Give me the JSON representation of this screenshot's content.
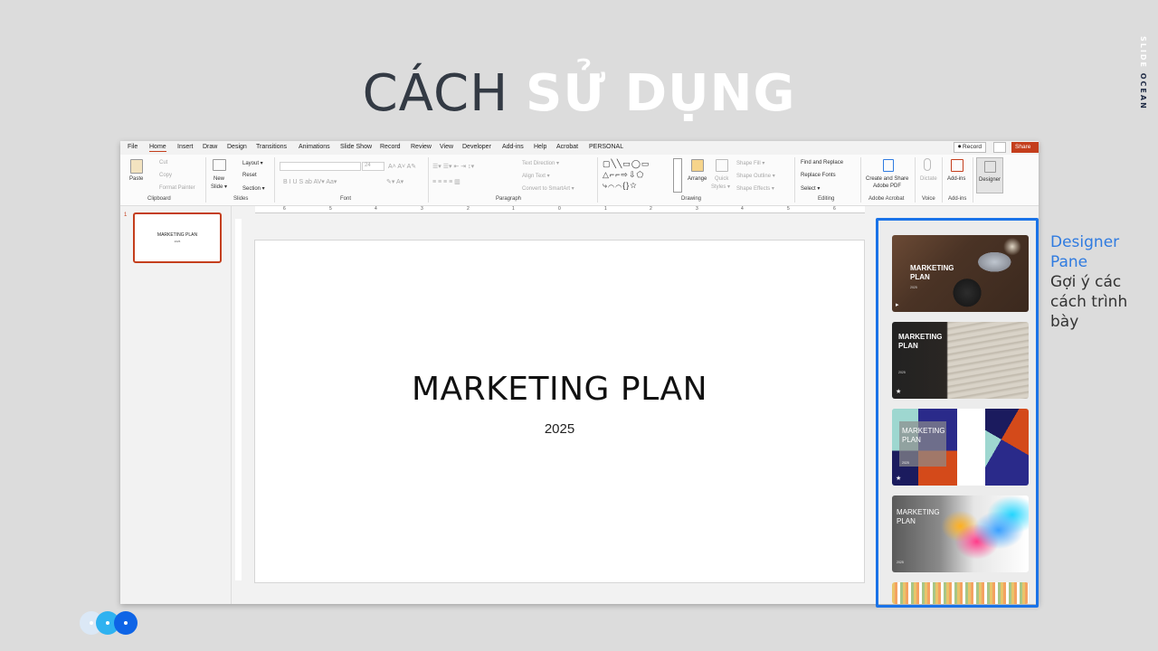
{
  "heading": {
    "part1": "CÁCH ",
    "part2": "SỬ DỤNG"
  },
  "brand": {
    "part1": "SLIDE ",
    "part2": "OCEAN"
  },
  "menu": {
    "tabs": [
      "File",
      "Home",
      "Insert",
      "Draw",
      "Design",
      "Transitions",
      "Animations",
      "Slide Show",
      "Record",
      "Review",
      "View",
      "Developer",
      "Add-ins",
      "Help",
      "Acrobat",
      "PERSONAL"
    ],
    "active_tab": "Home",
    "record_label": "⏺ Record",
    "share_label": "Share"
  },
  "ribbon": {
    "paste": "Paste",
    "cut": "Cut",
    "copy": "Copy",
    "format_painter": "Format Painter",
    "new_slide": "New",
    "new_slide_2": "Slide ▾",
    "layout": "Layout ▾",
    "reset": "Reset",
    "section": "Section ▾",
    "font_size": "24",
    "text_direction": "Text Direction ▾",
    "align_text": "Align Text ▾",
    "convert_smartart": "Convert to SmartArt ▾",
    "arrange": "Arrange",
    "quick_styles": "Quick",
    "quick_styles_2": "Styles ▾",
    "shape_fill": "Shape Fill ▾",
    "shape_outline": "Shape Outline ▾",
    "shape_effects": "Shape Effects ▾",
    "find_replace": "Find and Replace",
    "replace_fonts": "Replace Fonts",
    "select": "Select ▾",
    "create_share": "Create and Share",
    "adobe_pdf": "Adobe PDF",
    "dictate": "Dictate",
    "addins": "Add-ins",
    "designer": "Designer",
    "groups": [
      "Clipboard",
      "Slides",
      "Font",
      "Paragraph",
      "Drawing",
      "Editing",
      "Adobe Acrobat",
      "Voice",
      "Add-ins"
    ]
  },
  "ruler": [
    "6",
    "5",
    "4",
    "3",
    "2",
    "1",
    "0",
    "1",
    "2",
    "3",
    "4",
    "5",
    "6"
  ],
  "thumbnail": {
    "number": "1",
    "title": "MARKETING PLAN",
    "year": "2025"
  },
  "slide": {
    "title": "MARKETING PLAN",
    "subtitle": "2025"
  },
  "designer_cards": [
    {
      "title": "MARKETING PLAN",
      "year": "2025"
    },
    {
      "title": "MARKETING PLAN",
      "year": "2025"
    },
    {
      "title": "MARKETING PLAN",
      "year": "2025"
    },
    {
      "title": "MARKETING PLAN",
      "year": "2025"
    }
  ],
  "callout": {
    "title": "Designer Pane",
    "desc": "Gợi ý các cách trình bày"
  },
  "colors": {
    "accent": "#c43e1c",
    "highlight": "#1a73e8",
    "callout_title": "#2f7be0"
  }
}
